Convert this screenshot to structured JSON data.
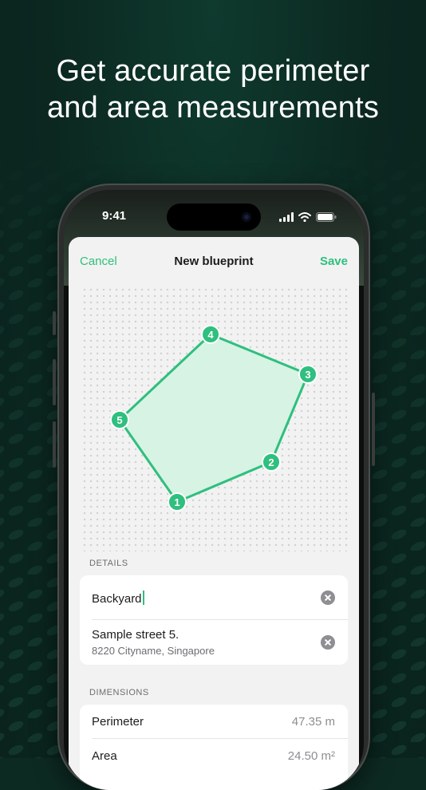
{
  "headline": {
    "line1": "Get accurate perimeter",
    "line2": "and area measurements"
  },
  "status_bar": {
    "time": "9:41"
  },
  "nav": {
    "cancel": "Cancel",
    "title": "New blueprint",
    "save": "Save"
  },
  "blueprint": {
    "points": [
      {
        "label": "1"
      },
      {
        "label": "2"
      },
      {
        "label": "3"
      },
      {
        "label": "4"
      },
      {
        "label": "5"
      }
    ]
  },
  "details": {
    "section_label": "DETAILS",
    "name_value": "Backyard",
    "address_line1": "Sample street 5.",
    "address_line2": "8220 Cityname, Singapore"
  },
  "dimensions": {
    "section_label": "DIMENSIONS",
    "rows": [
      {
        "label": "Perimeter",
        "value": "47.35 m"
      },
      {
        "label": "Area",
        "value": "24.50 m²"
      }
    ]
  },
  "colors": {
    "accent": "#2fbf7e",
    "fill": "#d6f3e4",
    "background": "#0d2a22"
  }
}
